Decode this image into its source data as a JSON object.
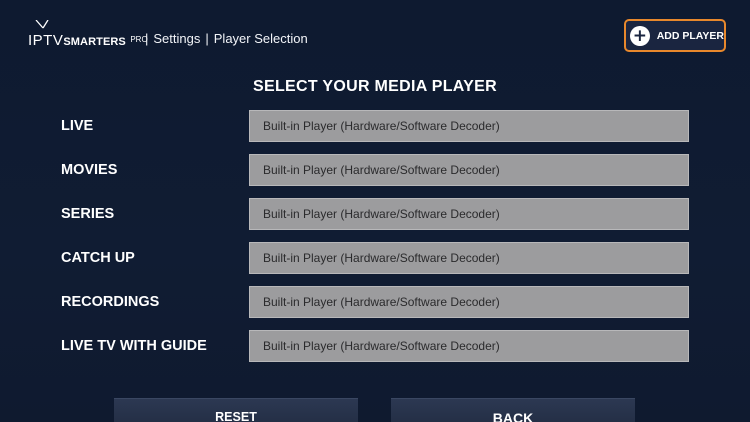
{
  "header": {
    "logo": {
      "iptv": "IPTV",
      "smarters": "SMARTERS",
      "pro": "PRO"
    },
    "breadcrumb": {
      "sep1": "|",
      "item1": "Settings",
      "sep2": "|",
      "item2": "Player Selection"
    },
    "add_player_icon": "plus-circle-icon",
    "add_player_label": "ADD PLAYER",
    "accent_color": "#e8882c"
  },
  "main": {
    "title": "SELECT YOUR MEDIA PLAYER",
    "rows": [
      {
        "label": "LIVE",
        "value": "Built-in Player (Hardware/Software Decoder)"
      },
      {
        "label": "MOVIES",
        "value": "Built-in Player (Hardware/Software Decoder)"
      },
      {
        "label": "SERIES",
        "value": "Built-in Player (Hardware/Software Decoder)"
      },
      {
        "label": "CATCH UP",
        "value": "Built-in Player (Hardware/Software Decoder)"
      },
      {
        "label": "RECORDINGS",
        "value": "Built-in Player (Hardware/Software Decoder)"
      },
      {
        "label": "LIVE TV WITH GUIDE",
        "value": "Built-in Player (Hardware/Software Decoder)"
      }
    ]
  },
  "footer": {
    "reset_label": "RESET",
    "back_label": "BACK"
  }
}
